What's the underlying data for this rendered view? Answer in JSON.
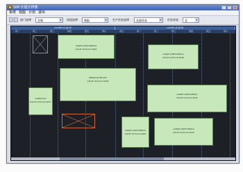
{
  "window": {
    "title": "SIM 计划工作表"
  },
  "titlebar": {
    "minimize_glyph": "–",
    "maximize_glyph": "□",
    "close_glyph": "×"
  },
  "menu": {
    "items": [
      "系统",
      "视图",
      "计划",
      "退出"
    ]
  },
  "toolbar": {
    "field1_label": "部门选择",
    "field1_value": "总装",
    "field2_label": "班组选择",
    "field2_value": "装配",
    "field3_label": "生产任务选择",
    "field3_value": "全部任务",
    "field4_label": "任务状态",
    "field4_value": "全",
    "caret_glyph": "▾"
  },
  "ruler": {
    "groups": [
      "2008年1月 第1周",
      "2008年1月 第2周"
    ],
    "ticks": [
      "周一",
      "周二",
      "周三",
      "周四",
      "周五",
      "周六",
      "周日",
      "周一",
      "周二",
      "周三",
      "周四",
      "周五",
      "周六"
    ]
  },
  "blocks": [
    {
      "id": "a",
      "title": "GXRW-CSM7048018",
      "sub": "CSLSF GCTLA3-0045"
    },
    {
      "id": "b",
      "title": "GXRW-CSM7048014",
      "sub": "CSLSF GCTLA3-0046"
    },
    {
      "id": "c",
      "title": "SMWM-6C3M-003",
      "sub": "CSLSF GCTLA3-0036"
    },
    {
      "id": "d",
      "title": "GXRW-6C3",
      "sub": "CSLSF GCTLA3-0037"
    },
    {
      "id": "e",
      "title": "GXRW-CSM7048021",
      "sub": "CSLSF GCTLA3-0041"
    },
    {
      "id": "f",
      "title": "GXRW-CSM7048022",
      "sub": "CSLSF GCTLA3-0042"
    },
    {
      "id": "g",
      "title": "GXRW-CSM7048015",
      "sub": "CSLSF GCTLA3-0043"
    }
  ],
  "colors": {
    "canvas_bg": "#1d2127",
    "block_fill": "#c6e8ba",
    "ruler_bg": "#3f5f95",
    "hatched_border": "#cf6a3a"
  }
}
